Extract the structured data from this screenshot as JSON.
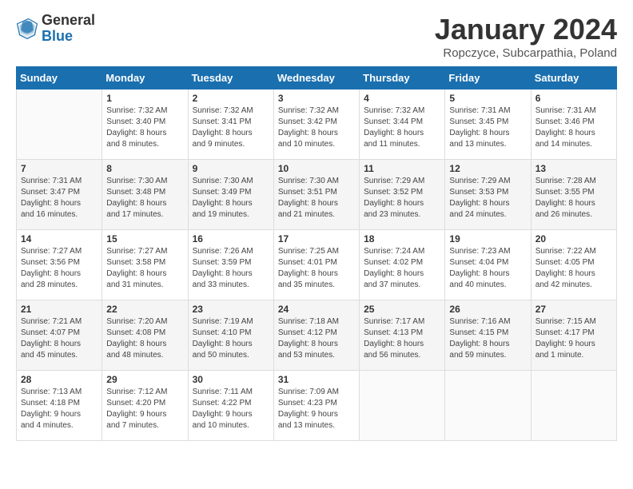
{
  "header": {
    "logo_general": "General",
    "logo_blue": "Blue",
    "title": "January 2024",
    "location": "Ropczyce, Subcarpathia, Poland"
  },
  "days_of_week": [
    "Sunday",
    "Monday",
    "Tuesday",
    "Wednesday",
    "Thursday",
    "Friday",
    "Saturday"
  ],
  "weeks": [
    [
      {
        "day": "",
        "content": ""
      },
      {
        "day": "1",
        "content": "Sunrise: 7:32 AM\nSunset: 3:40 PM\nDaylight: 8 hours\nand 8 minutes."
      },
      {
        "day": "2",
        "content": "Sunrise: 7:32 AM\nSunset: 3:41 PM\nDaylight: 8 hours\nand 9 minutes."
      },
      {
        "day": "3",
        "content": "Sunrise: 7:32 AM\nSunset: 3:42 PM\nDaylight: 8 hours\nand 10 minutes."
      },
      {
        "day": "4",
        "content": "Sunrise: 7:32 AM\nSunset: 3:44 PM\nDaylight: 8 hours\nand 11 minutes."
      },
      {
        "day": "5",
        "content": "Sunrise: 7:31 AM\nSunset: 3:45 PM\nDaylight: 8 hours\nand 13 minutes."
      },
      {
        "day": "6",
        "content": "Sunrise: 7:31 AM\nSunset: 3:46 PM\nDaylight: 8 hours\nand 14 minutes."
      }
    ],
    [
      {
        "day": "7",
        "content": "Sunrise: 7:31 AM\nSunset: 3:47 PM\nDaylight: 8 hours\nand 16 minutes."
      },
      {
        "day": "8",
        "content": "Sunrise: 7:30 AM\nSunset: 3:48 PM\nDaylight: 8 hours\nand 17 minutes."
      },
      {
        "day": "9",
        "content": "Sunrise: 7:30 AM\nSunset: 3:49 PM\nDaylight: 8 hours\nand 19 minutes."
      },
      {
        "day": "10",
        "content": "Sunrise: 7:30 AM\nSunset: 3:51 PM\nDaylight: 8 hours\nand 21 minutes."
      },
      {
        "day": "11",
        "content": "Sunrise: 7:29 AM\nSunset: 3:52 PM\nDaylight: 8 hours\nand 23 minutes."
      },
      {
        "day": "12",
        "content": "Sunrise: 7:29 AM\nSunset: 3:53 PM\nDaylight: 8 hours\nand 24 minutes."
      },
      {
        "day": "13",
        "content": "Sunrise: 7:28 AM\nSunset: 3:55 PM\nDaylight: 8 hours\nand 26 minutes."
      }
    ],
    [
      {
        "day": "14",
        "content": "Sunrise: 7:27 AM\nSunset: 3:56 PM\nDaylight: 8 hours\nand 28 minutes."
      },
      {
        "day": "15",
        "content": "Sunrise: 7:27 AM\nSunset: 3:58 PM\nDaylight: 8 hours\nand 31 minutes."
      },
      {
        "day": "16",
        "content": "Sunrise: 7:26 AM\nSunset: 3:59 PM\nDaylight: 8 hours\nand 33 minutes."
      },
      {
        "day": "17",
        "content": "Sunrise: 7:25 AM\nSunset: 4:01 PM\nDaylight: 8 hours\nand 35 minutes."
      },
      {
        "day": "18",
        "content": "Sunrise: 7:24 AM\nSunset: 4:02 PM\nDaylight: 8 hours\nand 37 minutes."
      },
      {
        "day": "19",
        "content": "Sunrise: 7:23 AM\nSunset: 4:04 PM\nDaylight: 8 hours\nand 40 minutes."
      },
      {
        "day": "20",
        "content": "Sunrise: 7:22 AM\nSunset: 4:05 PM\nDaylight: 8 hours\nand 42 minutes."
      }
    ],
    [
      {
        "day": "21",
        "content": "Sunrise: 7:21 AM\nSunset: 4:07 PM\nDaylight: 8 hours\nand 45 minutes."
      },
      {
        "day": "22",
        "content": "Sunrise: 7:20 AM\nSunset: 4:08 PM\nDaylight: 8 hours\nand 48 minutes."
      },
      {
        "day": "23",
        "content": "Sunrise: 7:19 AM\nSunset: 4:10 PM\nDaylight: 8 hours\nand 50 minutes."
      },
      {
        "day": "24",
        "content": "Sunrise: 7:18 AM\nSunset: 4:12 PM\nDaylight: 8 hours\nand 53 minutes."
      },
      {
        "day": "25",
        "content": "Sunrise: 7:17 AM\nSunset: 4:13 PM\nDaylight: 8 hours\nand 56 minutes."
      },
      {
        "day": "26",
        "content": "Sunrise: 7:16 AM\nSunset: 4:15 PM\nDaylight: 8 hours\nand 59 minutes."
      },
      {
        "day": "27",
        "content": "Sunrise: 7:15 AM\nSunset: 4:17 PM\nDaylight: 9 hours\nand 1 minute."
      }
    ],
    [
      {
        "day": "28",
        "content": "Sunrise: 7:13 AM\nSunset: 4:18 PM\nDaylight: 9 hours\nand 4 minutes."
      },
      {
        "day": "29",
        "content": "Sunrise: 7:12 AM\nSunset: 4:20 PM\nDaylight: 9 hours\nand 7 minutes."
      },
      {
        "day": "30",
        "content": "Sunrise: 7:11 AM\nSunset: 4:22 PM\nDaylight: 9 hours\nand 10 minutes."
      },
      {
        "day": "31",
        "content": "Sunrise: 7:09 AM\nSunset: 4:23 PM\nDaylight: 9 hours\nand 13 minutes."
      },
      {
        "day": "",
        "content": ""
      },
      {
        "day": "",
        "content": ""
      },
      {
        "day": "",
        "content": ""
      }
    ]
  ]
}
